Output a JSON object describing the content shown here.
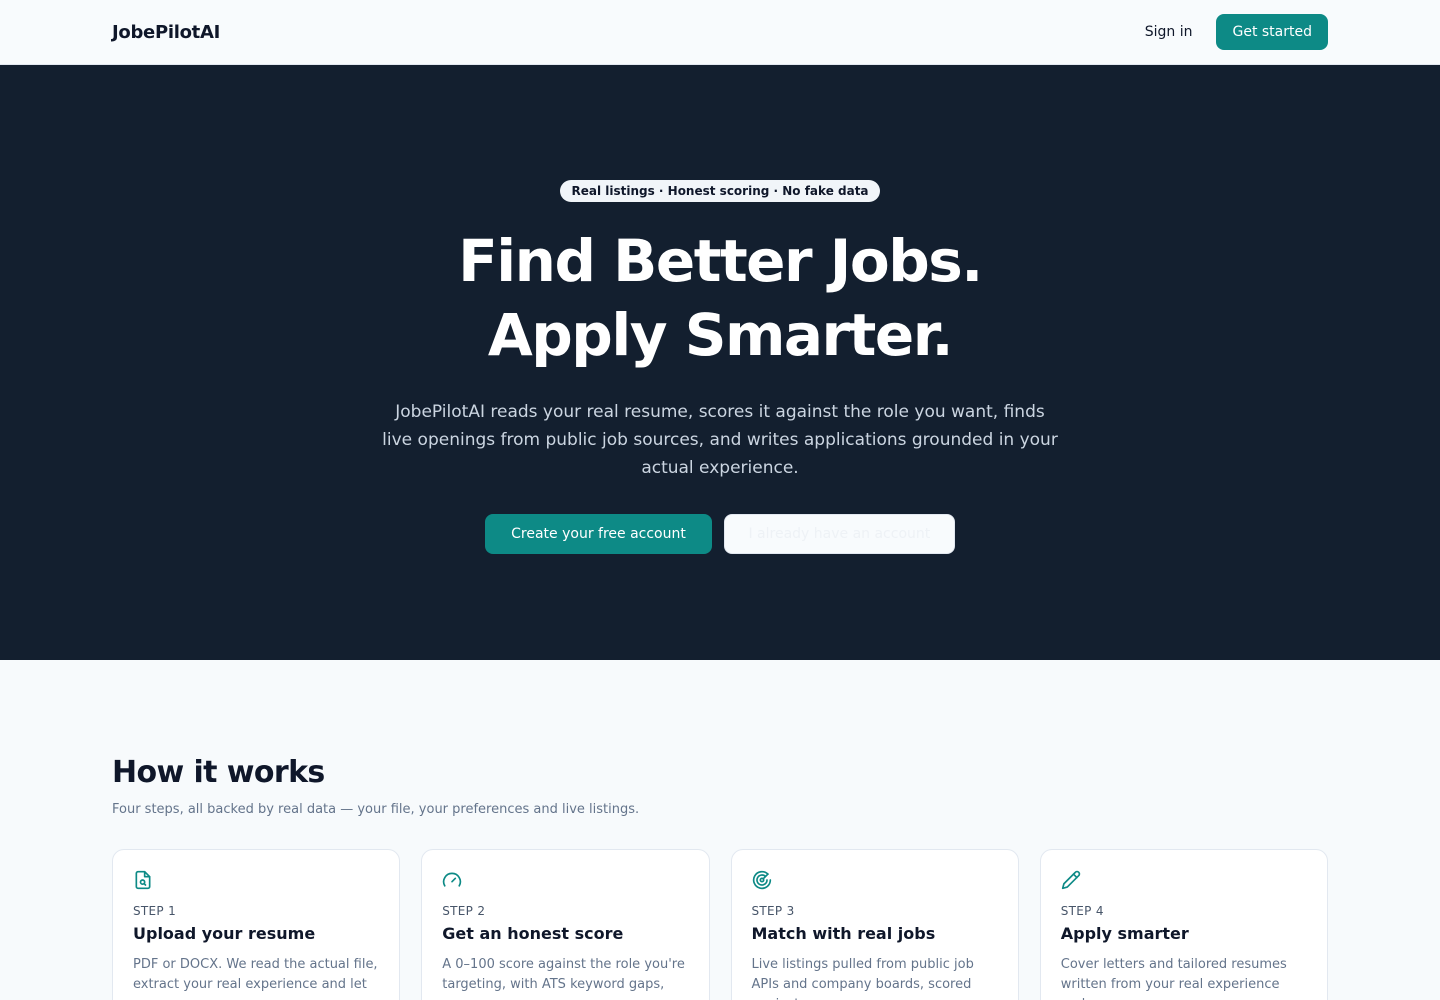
{
  "nav": {
    "brand": "JobePilotAI",
    "signin_label": "Sign in",
    "get_started_label": "Get started"
  },
  "hero": {
    "pill": "Real listings · Honest scoring · No fake data",
    "title": "Find Better Jobs. Apply Smarter.",
    "subtitle": "JobePilotAI reads your real resume, scores it against the role you want, finds live openings from public job sources, and writes applications grounded in your actual experience.",
    "primary_cta": "Create your free account",
    "secondary_cta": "I already have an account"
  },
  "how": {
    "title": "How it works",
    "subtitle": "Four steps, all backed by real data — your file, your preferences and live listings.",
    "steps": [
      {
        "icon": "file-search-icon",
        "step": "STEP 1",
        "title": "Upload your resume",
        "desc": "PDF or DOCX. We read the actual file, extract your real experience and let"
      },
      {
        "icon": "gauge-icon",
        "step": "STEP 2",
        "title": "Get an honest score",
        "desc": "A 0–100 score against the role you're targeting, with ATS keyword gaps,"
      },
      {
        "icon": "radar-icon",
        "step": "STEP 3",
        "title": "Match with real jobs",
        "desc": "Live listings pulled from public job APIs and company boards, scored against"
      },
      {
        "icon": "pencil-icon",
        "step": "STEP 4",
        "title": "Apply smarter",
        "desc": "Cover letters and tailored resumes written from your real experience and"
      }
    ]
  },
  "colors": {
    "accent": "#0d8a86",
    "hero_bg": "#131f2f",
    "page_bg": "#f7fafc"
  }
}
